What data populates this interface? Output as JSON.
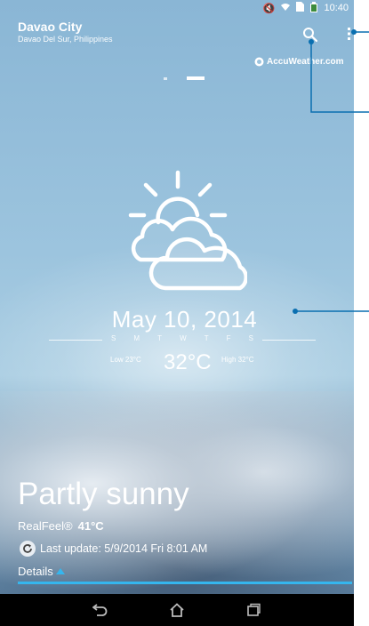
{
  "status": {
    "time": "10:40"
  },
  "location": {
    "city": "Davao City",
    "region": "Davao Del Sur, Philippines"
  },
  "provider": "AccuWeather.com",
  "icons": {
    "search": "search-icon",
    "menu": "overflow-menu-icon",
    "weather": "partly-sunny-icon",
    "refresh": "refresh-icon",
    "back": "back-icon",
    "home": "home-icon",
    "recents": "recent-apps-icon"
  },
  "date": "May 10, 2014",
  "weekdays": [
    "S",
    "M",
    "T",
    "W",
    "T",
    "F",
    "S"
  ],
  "temps": {
    "low": "Low 23°C",
    "current": "32°C",
    "high": "High 32°C"
  },
  "condition": "Partly sunny",
  "realfeel": {
    "label": "RealFeel®",
    "value": "41°C"
  },
  "last_update": "Last update: 5/9/2014 Fri  8:01 AM",
  "details_label": "Details",
  "colors": {
    "accent": "#35b6ee",
    "callout": "#0a6fb0"
  }
}
